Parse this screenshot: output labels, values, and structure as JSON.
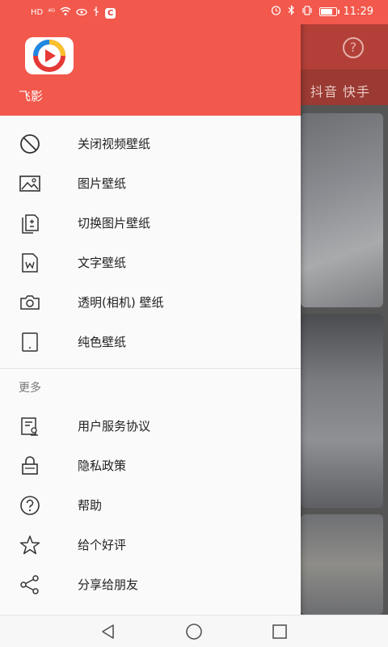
{
  "status_bar": {
    "left_mini": "HD",
    "signal": "⁴ᴳ",
    "right_time": "11:29"
  },
  "background": {
    "tabs_text": "抖音 快手",
    "help_icon": "question-circle-icon"
  },
  "drawer": {
    "app_name": "飞影",
    "items": [
      {
        "label": "关闭视频壁纸",
        "icon": "no-entry-icon"
      },
      {
        "label": "图片壁纸",
        "icon": "image-icon"
      },
      {
        "label": "切换图片壁纸",
        "icon": "switch-files-icon"
      },
      {
        "label": "文字壁纸",
        "icon": "word-doc-icon"
      },
      {
        "label": "透明(相机) 壁纸",
        "icon": "camera-icon"
      },
      {
        "label": "纯色壁纸",
        "icon": "tablet-icon"
      }
    ],
    "section_more": "更多",
    "more_items": [
      {
        "label": "用户服务协议",
        "icon": "agreement-icon"
      },
      {
        "label": "隐私政策",
        "icon": "lock-icon"
      },
      {
        "label": "帮助",
        "icon": "help-icon"
      },
      {
        "label": "给个好评",
        "icon": "star-icon"
      },
      {
        "label": "分享给朋友",
        "icon": "share-icon"
      }
    ]
  },
  "colors": {
    "accent": "#f2584c"
  }
}
